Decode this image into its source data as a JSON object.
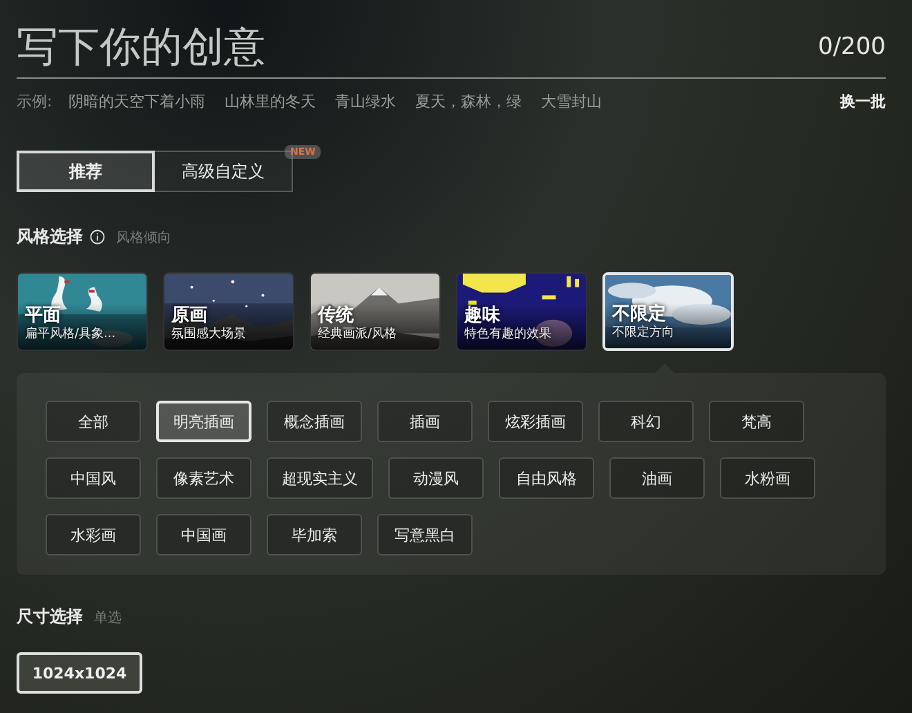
{
  "prompt": {
    "placeholder": "写下你的创意",
    "counter": "0/200"
  },
  "examples": {
    "label": "示例:",
    "items": [
      "阴暗的天空下着小雨",
      "山林里的冬天",
      "青山绿水",
      "夏天，森林，绿",
      "大雪封山"
    ],
    "refresh": "换一批"
  },
  "tabs": [
    {
      "label": "推荐",
      "selected": true
    },
    {
      "label": "高级自定义",
      "selected": false,
      "badge": "NEW"
    }
  ],
  "style_section": {
    "title": "风格选择",
    "hint": "风格倾向"
  },
  "style_cards": [
    {
      "title": "平面",
      "subtitle": "扁平风格/具象...",
      "selected": false
    },
    {
      "title": "原画",
      "subtitle": "氛围感大场景",
      "selected": false
    },
    {
      "title": "传统",
      "subtitle": "经典画派/风格",
      "selected": false
    },
    {
      "title": "趣味",
      "subtitle": "特色有趣的效果",
      "selected": false
    },
    {
      "title": "不限定",
      "subtitle": "不限定方向",
      "selected": true
    }
  ],
  "style_chips": [
    [
      {
        "label": "全部",
        "selected": false
      },
      {
        "label": "明亮插画",
        "selected": true
      },
      {
        "label": "概念插画",
        "selected": false
      },
      {
        "label": "插画",
        "selected": false
      },
      {
        "label": "炫彩插画",
        "selected": false
      },
      {
        "label": "科幻",
        "selected": false
      },
      {
        "label": "梵高",
        "selected": false
      }
    ],
    [
      {
        "label": "中国风",
        "selected": false
      },
      {
        "label": "像素艺术",
        "selected": false
      },
      {
        "label": "超现实主义",
        "selected": false
      },
      {
        "label": "动漫风",
        "selected": false
      },
      {
        "label": "自由风格",
        "selected": false
      },
      {
        "label": "油画",
        "selected": false
      },
      {
        "label": "水粉画",
        "selected": false
      }
    ],
    [
      {
        "label": "水彩画",
        "selected": false
      },
      {
        "label": "中国画",
        "selected": false
      },
      {
        "label": "毕加索",
        "selected": false
      },
      {
        "label": "写意黑白",
        "selected": false
      }
    ]
  ],
  "size_section": {
    "title": "尺寸选择",
    "hint": "单选"
  },
  "sizes": [
    {
      "label": "1024x1024",
      "selected": true
    }
  ]
}
